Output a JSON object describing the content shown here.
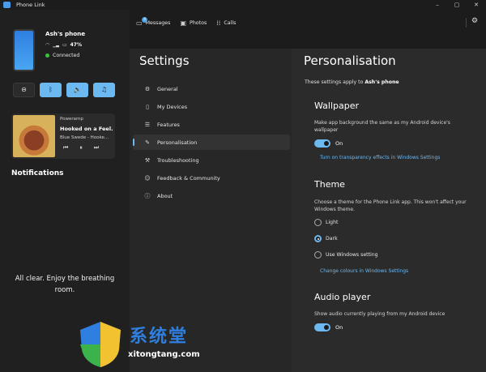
{
  "window": {
    "title": "Phone Link",
    "minimize": "–",
    "maximize": "▢",
    "close": "✕"
  },
  "phone": {
    "name": "Ash's phone",
    "signal": "📶",
    "battery": "47%",
    "status": "Connected"
  },
  "quick_actions": [
    {
      "icon": "do-not-disturb-icon",
      "glyph": "⊖"
    },
    {
      "icon": "bluetooth-icon",
      "glyph": "ᛒ"
    },
    {
      "icon": "speaker-icon",
      "glyph": "🔈"
    },
    {
      "icon": "music-icon",
      "glyph": "♫"
    }
  ],
  "media": {
    "app": "Poweramp",
    "title": "Hooked on a Feel...",
    "artist": "Blue Swede - Hooke...",
    "prev": "⏮",
    "pause": "⏸",
    "next": "⏭"
  },
  "notifications": {
    "title": "Notifications",
    "empty": "All clear. Enjoy the breathing room."
  },
  "tabs": [
    {
      "label": "Messages",
      "icon": "messages-icon",
      "badge": "4"
    },
    {
      "label": "Photos",
      "icon": "photos-icon"
    },
    {
      "label": "Calls",
      "icon": "calls-icon"
    }
  ],
  "settings": {
    "title": "Settings",
    "nav": [
      {
        "label": "General",
        "icon": "gear-icon"
      },
      {
        "label": "My Devices",
        "icon": "phone-icon"
      },
      {
        "label": "Features",
        "icon": "features-icon"
      },
      {
        "label": "Personalisation",
        "icon": "pen-icon"
      },
      {
        "label": "Troubleshooting",
        "icon": "wrench-icon"
      },
      {
        "label": "Feedback & Community",
        "icon": "feedback-icon"
      },
      {
        "label": "About",
        "icon": "info-icon"
      }
    ]
  },
  "content": {
    "title": "Personalisation",
    "applies_prefix": "These settings apply to",
    "applies_device": "Ash's phone",
    "wallpaper": {
      "heading": "Wallpaper",
      "desc": "Make app background the same as my Android device's wallpaper",
      "toggle": "On",
      "link": "Turn on transparency effects in Windows Settings"
    },
    "theme": {
      "heading": "Theme",
      "desc": "Choose a theme for the Phone Link app. This won't affect your Windows theme.",
      "options": [
        "Light",
        "Dark",
        "Use Windows setting"
      ],
      "selected": "Dark",
      "link": "Change colours in Windows Settings"
    },
    "audio": {
      "heading": "Audio player",
      "desc": "Show audio currently playing from my Android device",
      "toggle": "On"
    }
  },
  "watermark": {
    "cn": "系统堂",
    "url": "xitongtang.com"
  },
  "colors": {
    "accent": "#6cb8f0",
    "status_green": "#3fbf3f",
    "background": "#1c1c1c"
  }
}
